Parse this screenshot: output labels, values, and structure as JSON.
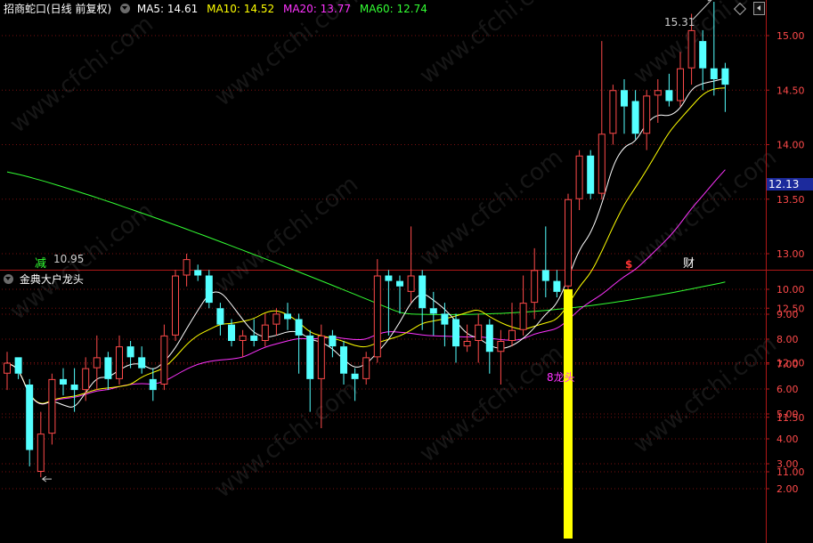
{
  "main_panel": {
    "title": "招商蛇口(日线 前复权)",
    "ma_labels": [
      {
        "text": "MA5: 14.61",
        "color": "#ffffff"
      },
      {
        "text": "MA10: 14.52",
        "color": "#ffff00"
      },
      {
        "text": "MA20: 13.77",
        "color": "#ff33ff"
      },
      {
        "text": "MA60: 12.74",
        "color": "#33ff33"
      }
    ],
    "high_note": "15.31",
    "low_note": "10.95",
    "current_price": "12.13",
    "markers": [
      {
        "text": "减",
        "color": "#33ff33"
      },
      {
        "text": "$",
        "color": "#ff3333"
      },
      {
        "text": "财",
        "color": "#ffffff"
      }
    ]
  },
  "sub_panel": {
    "title": "金典大户龙头",
    "bar_label": "8龙头"
  },
  "watermark": "www.cfchi.com",
  "colors": {
    "up": "#ff4a4a",
    "down": "#54ffff",
    "grid": "#7a1010",
    "axis": "#b01818",
    "ma5": "#ffffff",
    "ma10": "#ffff00",
    "ma20": "#ff33ff",
    "ma60": "#33ff33",
    "signal_bar": "#ffff00",
    "signal_text": "#ff33ff"
  },
  "chart_data": [
    {
      "type": "candlestick",
      "title": "招商蛇口(日线 前复权)",
      "ylim": [
        10.75,
        15.45
      ],
      "yticks": [
        "15.00",
        "14.50",
        "14.00",
        "13.50",
        "13.00",
        "12.50",
        "12.00",
        "11.50",
        "11.00"
      ],
      "ohlc": [
        [
          11.9,
          12.1,
          11.75,
          12.0
        ],
        [
          12.05,
          12.05,
          11.85,
          11.9
        ],
        [
          11.8,
          11.85,
          11.05,
          11.2
        ],
        [
          11.0,
          11.55,
          10.95,
          11.35
        ],
        [
          11.35,
          11.9,
          11.25,
          11.85
        ],
        [
          11.85,
          11.95,
          11.7,
          11.8
        ],
        [
          11.8,
          11.95,
          11.55,
          11.75
        ],
        [
          11.75,
          12.05,
          11.65,
          11.95
        ],
        [
          11.95,
          12.25,
          11.75,
          12.05
        ],
        [
          12.05,
          12.1,
          11.75,
          11.85
        ],
        [
          11.85,
          12.25,
          11.8,
          12.15
        ],
        [
          12.15,
          12.2,
          11.95,
          12.05
        ],
        [
          12.05,
          12.15,
          11.9,
          11.95
        ],
        [
          11.85,
          11.95,
          11.65,
          11.75
        ],
        [
          11.8,
          12.35,
          11.75,
          12.25
        ],
        [
          12.25,
          12.85,
          12.2,
          12.8
        ],
        [
          12.8,
          13.0,
          12.7,
          12.95
        ],
        [
          12.85,
          12.9,
          12.75,
          12.8
        ],
        [
          12.8,
          12.85,
          12.5,
          12.55
        ],
        [
          12.5,
          12.55,
          12.25,
          12.35
        ],
        [
          12.35,
          12.4,
          12.15,
          12.2
        ],
        [
          12.2,
          12.3,
          12.05,
          12.25
        ],
        [
          12.25,
          12.4,
          12.15,
          12.2
        ],
        [
          12.2,
          12.45,
          12.15,
          12.35
        ],
        [
          12.35,
          12.5,
          12.25,
          12.45
        ],
        [
          12.45,
          12.55,
          12.3,
          12.4
        ],
        [
          12.4,
          12.45,
          11.9,
          12.25
        ],
        [
          12.25,
          12.3,
          11.55,
          11.85
        ],
        [
          11.85,
          12.35,
          11.4,
          12.25
        ],
        [
          12.25,
          12.3,
          12.05,
          12.15
        ],
        [
          12.15,
          12.2,
          11.8,
          11.9
        ],
        [
          11.9,
          11.95,
          11.65,
          11.85
        ],
        [
          11.85,
          12.1,
          11.8,
          12.05
        ],
        [
          12.05,
          12.95,
          12.0,
          12.8
        ],
        [
          12.8,
          12.85,
          12.25,
          12.75
        ],
        [
          12.75,
          12.8,
          12.45,
          12.7
        ],
        [
          12.65,
          13.25,
          12.55,
          12.8
        ],
        [
          12.8,
          12.85,
          12.3,
          12.5
        ],
        [
          12.5,
          12.65,
          12.25,
          12.45
        ],
        [
          12.45,
          12.55,
          12.15,
          12.35
        ],
        [
          12.4,
          12.45,
          12.0,
          12.15
        ],
        [
          12.15,
          12.35,
          12.1,
          12.2
        ],
        [
          12.2,
          12.45,
          12.0,
          12.35
        ],
        [
          12.35,
          12.4,
          11.9,
          12.1
        ],
        [
          12.1,
          12.3,
          11.8,
          12.2
        ],
        [
          12.2,
          12.55,
          12.15,
          12.3
        ],
        [
          12.3,
          12.8,
          12.25,
          12.55
        ],
        [
          12.55,
          13.05,
          12.4,
          12.85
        ],
        [
          12.85,
          13.25,
          12.6,
          12.75
        ],
        [
          12.75,
          12.85,
          12.6,
          12.65
        ],
        [
          12.7,
          13.55,
          12.55,
          13.5
        ],
        [
          13.5,
          13.95,
          13.4,
          13.9
        ],
        [
          13.9,
          13.95,
          13.5,
          13.55
        ],
        [
          13.55,
          14.95,
          13.5,
          14.1
        ],
        [
          14.1,
          14.55,
          14.0,
          14.5
        ],
        [
          14.5,
          14.6,
          14.1,
          14.35
        ],
        [
          14.4,
          14.5,
          14.05,
          14.1
        ],
        [
          14.1,
          14.5,
          13.95,
          14.45
        ],
        [
          14.45,
          14.6,
          14.2,
          14.5
        ],
        [
          14.5,
          14.65,
          14.35,
          14.4
        ],
        [
          14.4,
          14.85,
          14.35,
          14.7
        ],
        [
          14.7,
          15.2,
          14.55,
          15.05
        ],
        [
          14.95,
          15.05,
          14.5,
          14.7
        ],
        [
          14.7,
          15.31,
          14.45,
          14.6
        ],
        [
          14.7,
          14.75,
          14.3,
          14.55
        ]
      ],
      "series": [
        {
          "name": "MA5",
          "last": 14.61
        },
        {
          "name": "MA10",
          "last": 14.52
        },
        {
          "name": "MA20",
          "last": 13.77
        },
        {
          "name": "MA60",
          "last": 12.74
        }
      ]
    },
    {
      "type": "bar",
      "title": "金典大户龙头",
      "ylim": [
        0,
        10.5
      ],
      "yticks": [
        "10.00",
        "9.00",
        "8.00",
        "7.00",
        "6.00",
        "5.00",
        "4.00",
        "3.00",
        "2.00"
      ],
      "bars": [
        {
          "index": 50,
          "value": 10
        }
      ]
    }
  ]
}
